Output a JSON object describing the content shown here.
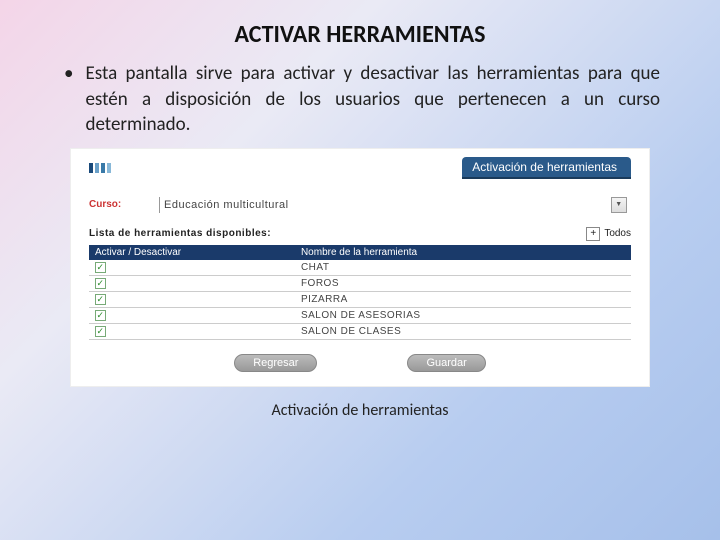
{
  "title": "ACTIVAR HERRAMIENTAS",
  "bullet": "Esta pantalla sirve para activar y desactivar las herramientas para que estén a disposición de los usuarios que pertenecen a un curso determinado.",
  "screenshot": {
    "tab": "Activación de herramientas",
    "curso_label": "Curso:",
    "curso_value": "Educación multicultural",
    "lista_label": "Lista de herramientas disponibles:",
    "todos_label": "Todos",
    "plus": "+",
    "header_col1": "Activar / Desactivar",
    "header_col2": "Nombre de la herramienta",
    "rows": {
      "r0": "CHAT",
      "r1": "FOROS",
      "r2": "PIZARRA",
      "r3": "SALON DE ASESORIAS",
      "r4": "SALON DE CLASES"
    },
    "btn_back": "Regresar",
    "btn_save": "Guardar"
  },
  "caption": "Activación de herramientas"
}
